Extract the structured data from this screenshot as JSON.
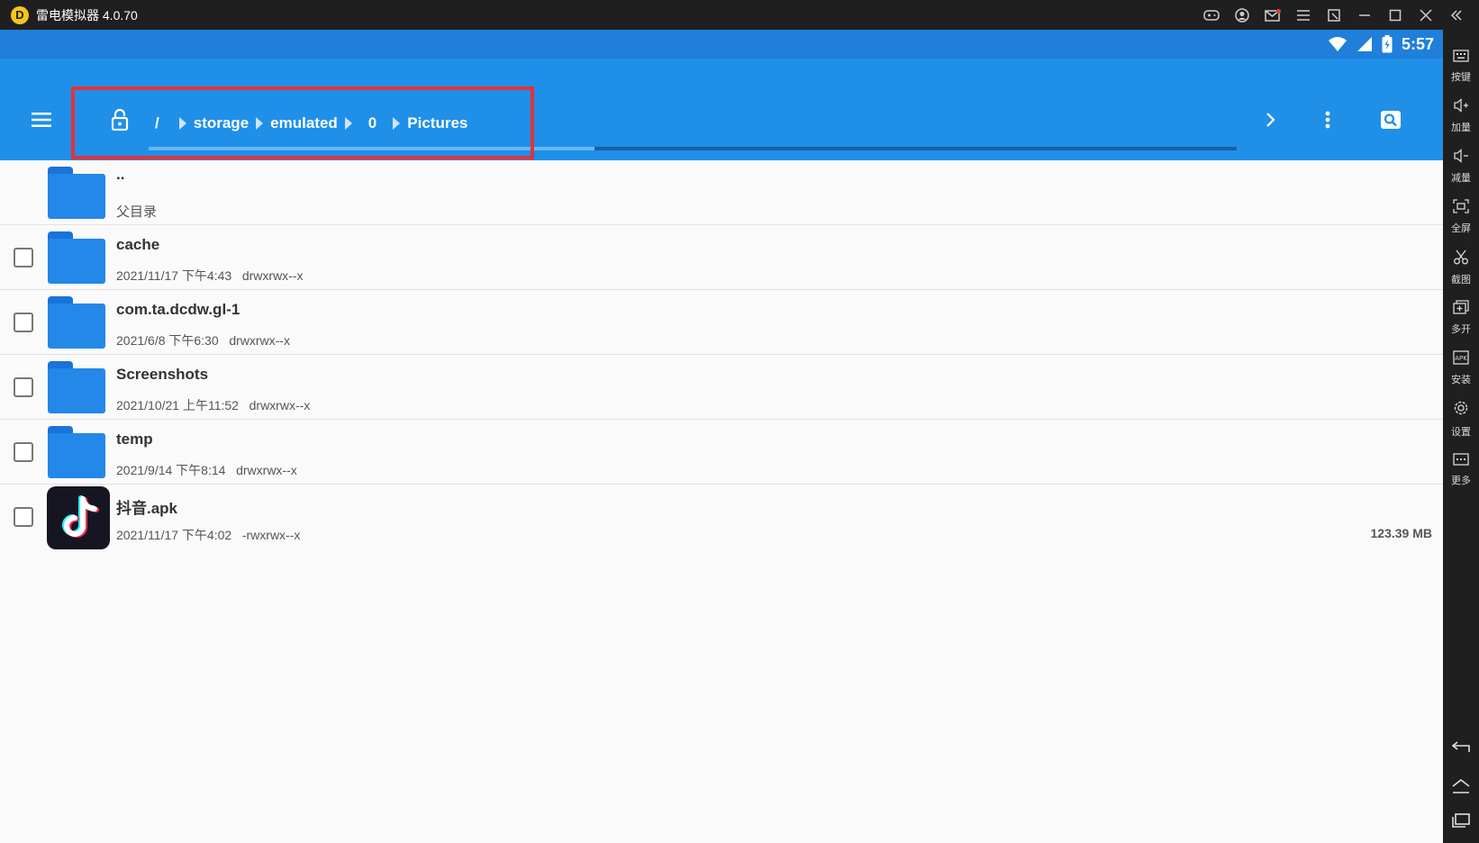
{
  "window": {
    "title": "雷电模拟器 4.0.70",
    "logo_letter": "D"
  },
  "status_bar": {
    "time": "5:57"
  },
  "breadcrumb": {
    "items": [
      "/",
      "storage",
      "emulated",
      "0",
      "Pictures"
    ]
  },
  "path_load_progress": 0.41,
  "file_list": {
    "parent": {
      "name": "..",
      "label": "父目录"
    },
    "items": [
      {
        "name": "cache",
        "date": "2021/11/17 下午4:43",
        "perms": "drwxrwx--x",
        "size": ""
      },
      {
        "name": "com.ta.dcdw.gl-1",
        "date": "2021/6/8 下午6:30",
        "perms": "drwxrwx--x",
        "size": ""
      },
      {
        "name": "Screenshots",
        "date": "2021/10/21 上午11:52",
        "perms": "drwxrwx--x",
        "size": ""
      },
      {
        "name": "temp",
        "date": "2021/9/14 下午8:14",
        "perms": "drwxrwx--x",
        "size": ""
      },
      {
        "name": "抖音.apk",
        "date": "2021/11/17 下午4:02",
        "perms": "-rwxrwx--x",
        "size": "123.39 MB"
      }
    ]
  },
  "emulator_sidebar": {
    "buttons": [
      {
        "label": "按键",
        "icon": "keyboard-icon"
      },
      {
        "label": "加量",
        "icon": "volume-up-icon"
      },
      {
        "label": "减量",
        "icon": "volume-down-icon"
      },
      {
        "label": "全屏",
        "icon": "fullscreen-icon"
      },
      {
        "label": "截图",
        "icon": "scissors-icon"
      },
      {
        "label": "多开",
        "icon": "multi-instance-icon"
      },
      {
        "label": "安装",
        "icon": "apk-install-icon"
      },
      {
        "label": "设置",
        "icon": "gear-icon"
      },
      {
        "label": "更多",
        "icon": "more-icon"
      }
    ]
  },
  "colors": {
    "toolbar": "#208fe8",
    "status_bar": "#1f7fdb",
    "folder": "#2388e8",
    "highlight": "#e2323b"
  }
}
